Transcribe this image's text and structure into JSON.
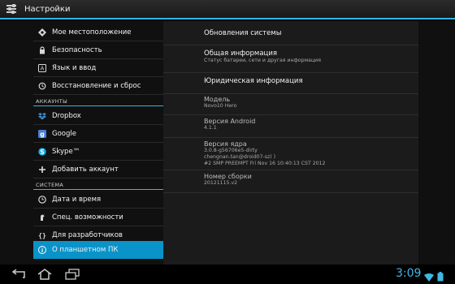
{
  "app": {
    "title": "Настройки"
  },
  "sidebar": {
    "items": [
      {
        "type": "row",
        "label": "Мое местоположение",
        "icon": "location-icon"
      },
      {
        "type": "row",
        "label": "Безопасность",
        "icon": "lock-icon"
      },
      {
        "type": "row",
        "label": "Язык и ввод",
        "icon": "language-icon"
      },
      {
        "type": "row",
        "label": "Восстановление и сброс",
        "icon": "restore-icon"
      },
      {
        "type": "header",
        "label": "АККАУНТЫ"
      },
      {
        "type": "row",
        "label": "Dropbox",
        "icon": "dropbox-icon"
      },
      {
        "type": "row",
        "label": "Google",
        "icon": "google-icon"
      },
      {
        "type": "row",
        "label": "Skype™",
        "icon": "skype-icon"
      },
      {
        "type": "row",
        "label": "Добавить аккаунт",
        "icon": "plus-icon"
      },
      {
        "type": "header",
        "label": "СИСТЕМА"
      },
      {
        "type": "row",
        "label": "Дата и время",
        "icon": "clock-icon"
      },
      {
        "type": "row",
        "label": "Спец. возможности",
        "icon": "accessibility-icon"
      },
      {
        "type": "row",
        "label": "Для разработчиков",
        "icon": "braces-icon"
      },
      {
        "type": "row",
        "label": "О планшетном ПК",
        "icon": "info-icon",
        "active": true
      }
    ]
  },
  "about": {
    "updates": "Обновления системы",
    "general_title": "Общая информация",
    "general_sub": "Статус батареи, сети и другая информация",
    "legal": "Юридическая информация",
    "model_label": "Модель",
    "model_value": "Novo10 Hero",
    "android_label": "Версия Android",
    "android_value": "4.1.1",
    "kernel_label": "Версия ядра",
    "kernel_line1": "3.0.8-g56706e5-dirty",
    "kernel_line2": "chengnan.tan@droid07-sz) )",
    "kernel_line3": "#2 SMP PREEMPT Fri Nov 16 10:40:13 CST 2012",
    "build_label": "Номер сборки",
    "build_value": "20121115.v2"
  },
  "statusbar": {
    "time": "3:09"
  },
  "colors": {
    "accent": "#33b5e5",
    "active_row": "#0a93c8",
    "clock": "#3fb8e6"
  }
}
